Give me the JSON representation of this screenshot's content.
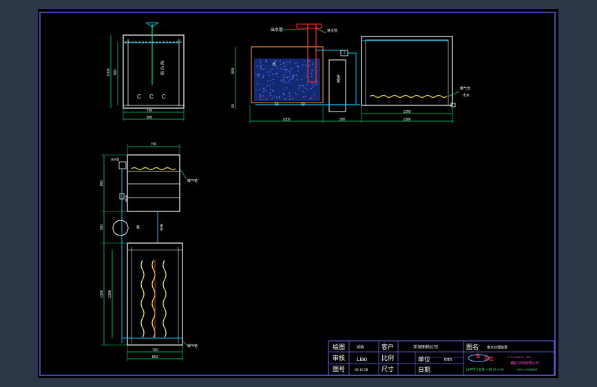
{
  "drawing": {
    "front_view": {
      "dim_inner_width": "700",
      "dim_outer_width": "800",
      "dim_height_outer": "1000",
      "dim_height_inner": "900",
      "vertical_label": "说 点 说"
    },
    "side_view": {
      "pipe_label_left": "出水管",
      "pipe_label_right": "进水管",
      "dim_height_top": "800",
      "dim_height_bottom": "50",
      "dim_tank_width": "1000",
      "dim_gap": "300",
      "dim_right_inner": "1200",
      "dim_right_outer": "1300",
      "aerator_label": "曝气管",
      "outlet_label": "出水",
      "tank_mark": "水",
      "pump_label": "水泵"
    },
    "plan_view": {
      "dim_top_width": "700",
      "dim_bottom_inner": "700",
      "dim_bottom_outer": "800",
      "dim_left_upper": "800",
      "dim_left_mid": "300",
      "dim_left_lower": "1300",
      "dim_inner_lower": "1200",
      "aerator_label_upper": "曝气管",
      "aerator_label_lower": "曝气管",
      "small_label": "进水管",
      "pipe_mark_1": "出水",
      "pipe_mark_2": "进水",
      "pump_mark": "泵"
    }
  },
  "title_block": {
    "drawn_label": "绘图",
    "drawn_value": "xia",
    "client_label": "客户",
    "client_value": "学海图档公司",
    "drawing_name_label": "图名",
    "drawing_name_value": "废水处理装置",
    "check_label": "审核",
    "check_value": "Liao",
    "scale_label": "比例",
    "unit_label": "单位",
    "unit_value": "mm",
    "number_label": "图号",
    "number_value": "00 10 28",
    "size_label": "尺寸",
    "date_label": "日期",
    "logo_text": "君胜",
    "company_line1": "F 010 010 20 , 100",
    "company_line2": "钢联 材料有限公司",
    "company_line3": "山中市工业区  一街 13 一16",
    "company_line4": "020 1 16345655"
  }
}
